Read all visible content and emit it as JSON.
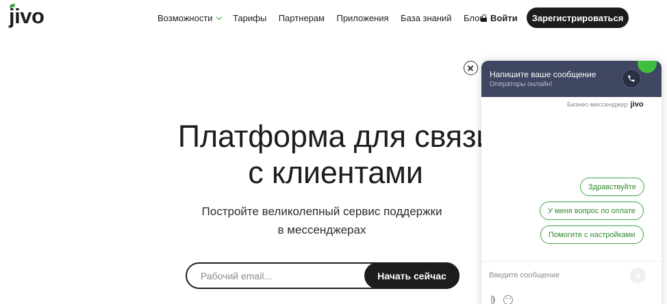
{
  "header": {
    "logo_text": "jivo",
    "nav": [
      {
        "label": "Возможности",
        "has_dropdown": true
      },
      {
        "label": "Тарифы"
      },
      {
        "label": "Партнерам"
      },
      {
        "label": "Приложения"
      },
      {
        "label": "База знаний"
      },
      {
        "label": "Блог"
      }
    ],
    "login_label": "Войти",
    "register_label": "Зарегистрироваться"
  },
  "hero": {
    "title_line1": "Платформа для связи",
    "title_line2": "с клиентами",
    "subtitle_line1": "Постройте великолепный сервис поддержки",
    "subtitle_line2": "в мессенджерах",
    "email_placeholder": "Рабочий email...",
    "cta_label": "Начать сейчас"
  },
  "chat_widget": {
    "title": "Напишите ваше сообщение",
    "status": "Операторы онлайн!",
    "brand_label": "Бизнес-мессенджер",
    "brand_logo": "jivo",
    "quick_replies": [
      "Здравствуйте",
      "У меня вопрос по оплате",
      "Помогите с настройками"
    ],
    "input_placeholder": "Введите сообщение"
  },
  "colors": {
    "accent_green": "#3fa540",
    "dark": "#1d1d1f",
    "widget_header": "#3f4662"
  }
}
